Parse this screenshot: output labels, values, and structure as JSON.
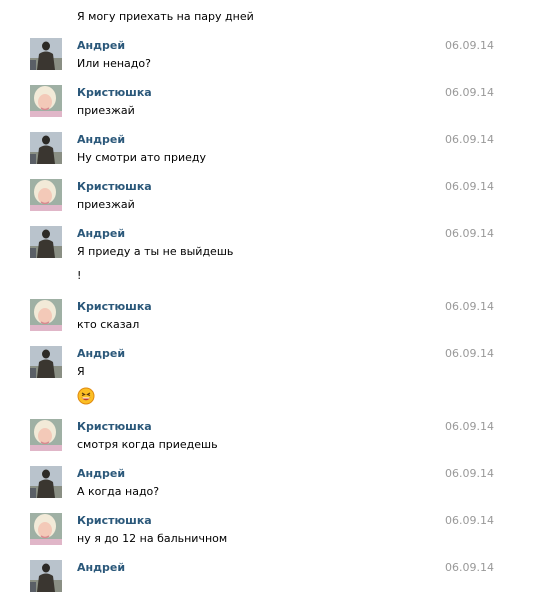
{
  "messages": [
    {
      "type": "continuation",
      "text": "Я могу приехать на пару дней"
    },
    {
      "author": "Андрей",
      "avatar": "andrey",
      "date": "06.09.14",
      "text": "Или ненадо?"
    },
    {
      "author": "Кристюшка",
      "avatar": "kristyushka",
      "date": "06.09.14",
      "text": "приезжай"
    },
    {
      "author": "Андрей",
      "avatar": "andrey",
      "date": "06.09.14",
      "text": "Ну смотри ато приеду"
    },
    {
      "author": "Кристюшка",
      "avatar": "kristyushka",
      "date": "06.09.14",
      "text": "приезжай"
    },
    {
      "author": "Андрей",
      "avatar": "andrey",
      "date": "06.09.14",
      "text": "Я приеду а ты не выйдешь",
      "extra": "!"
    },
    {
      "author": "Кристюшка",
      "avatar": "kristyushka",
      "date": "06.09.14",
      "text": "кто сказал"
    },
    {
      "author": "Андрей",
      "avatar": "andrey",
      "date": "06.09.14",
      "text": "Я",
      "emoji": "laughing-face-icon"
    },
    {
      "author": "Кристюшка",
      "avatar": "kristyushka",
      "date": "06.09.14",
      "text": "смотря когда приедешь"
    },
    {
      "author": "Андрей",
      "avatar": "andrey",
      "date": "06.09.14",
      "text": "А когда надо?"
    },
    {
      "author": "Кристюшка",
      "avatar": "kristyushka",
      "date": "06.09.14",
      "text": "ну я до 12 на бальничном"
    },
    {
      "author": "Андрей",
      "avatar": "andrey",
      "date": "06.09.14",
      "text": ""
    }
  ],
  "colors": {
    "author": "#2b587a",
    "date": "#999999",
    "text": "#000000"
  }
}
